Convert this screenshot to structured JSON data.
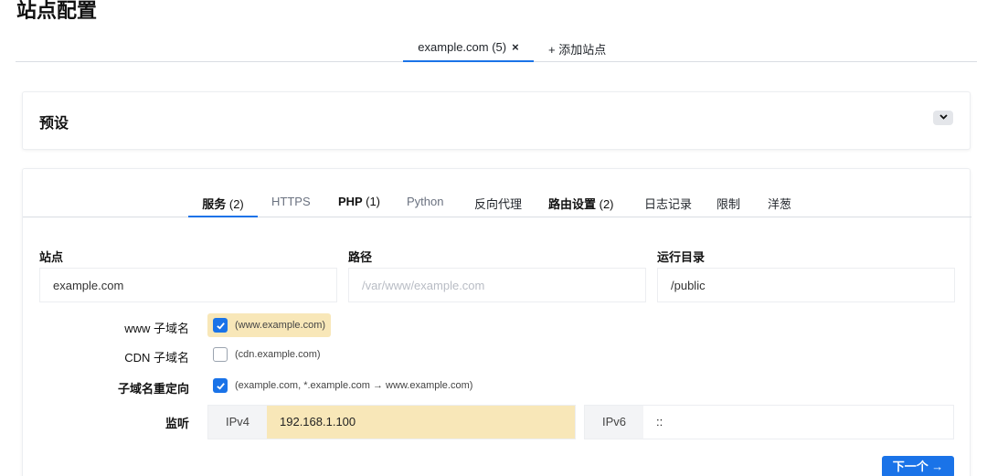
{
  "page_title": "站点配置",
  "site_tabs": {
    "active_label": "example.com (5)",
    "close_symbol": "×",
    "add_label": "+ 添加站点"
  },
  "preset": {
    "title": "预设",
    "collapse_icon": "chevron-down-icon"
  },
  "section_tabs": [
    {
      "label": "服务 ",
      "count": "(2)",
      "active": true
    },
    {
      "label": "HTTPS"
    },
    {
      "label": "PHP ",
      "count": "(1)"
    },
    {
      "label": "Python"
    },
    {
      "label": "反向代理"
    },
    {
      "label": "路由设置 ",
      "count": "(2)"
    },
    {
      "label": "日志记录"
    },
    {
      "label": "限制"
    },
    {
      "label": "洋葱"
    }
  ],
  "fields": {
    "site": {
      "label": "站点",
      "value": "example.com"
    },
    "path": {
      "label": "路径",
      "placeholder": "/var/www/example.com"
    },
    "workdir": {
      "label": "运行目录",
      "value": "/public"
    }
  },
  "options": {
    "www": {
      "label": "www 子域名",
      "text": "(www.example.com)",
      "checked": true
    },
    "cdn": {
      "label": "CDN 子域名",
      "text": "(cdn.example.com)",
      "checked": false
    },
    "redirect": {
      "label": "子域名重定向",
      "text": "(example.com, *.example.com → www.example.com)",
      "checked": true
    }
  },
  "listen": {
    "label": "监听",
    "ipv4_tag": "IPv4",
    "ipv4_value": "192.168.1.100",
    "ipv6_tag": "IPv6",
    "ipv6_value": "::"
  },
  "next_button": "下一个 →",
  "colors": {
    "accent": "#1a73e8",
    "highlight": "#f8e7b8"
  }
}
